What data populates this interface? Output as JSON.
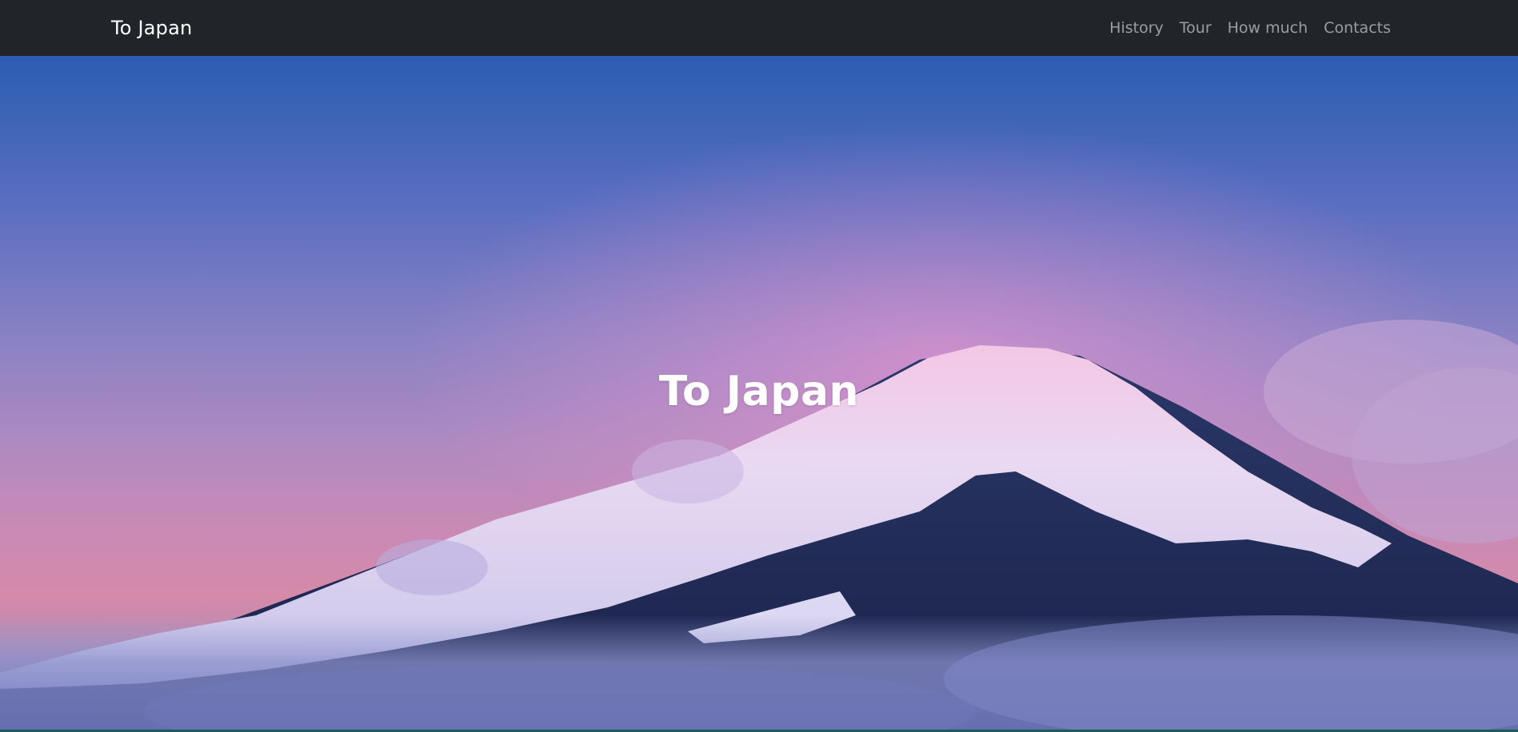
{
  "navbar": {
    "brand": "To Japan",
    "links": [
      {
        "label": "History"
      },
      {
        "label": "Tour"
      },
      {
        "label": "How much"
      },
      {
        "label": "Contacts"
      }
    ]
  },
  "hero": {
    "title": "To Japan",
    "image_subject": "snow-capped mountain at dusk above clouds"
  },
  "colors": {
    "navbar_bg": "#212529",
    "brand_text": "#ffffff",
    "nav_link_text": "rgba(255,255,255,0.55)",
    "hero_title": "#ffffff"
  }
}
